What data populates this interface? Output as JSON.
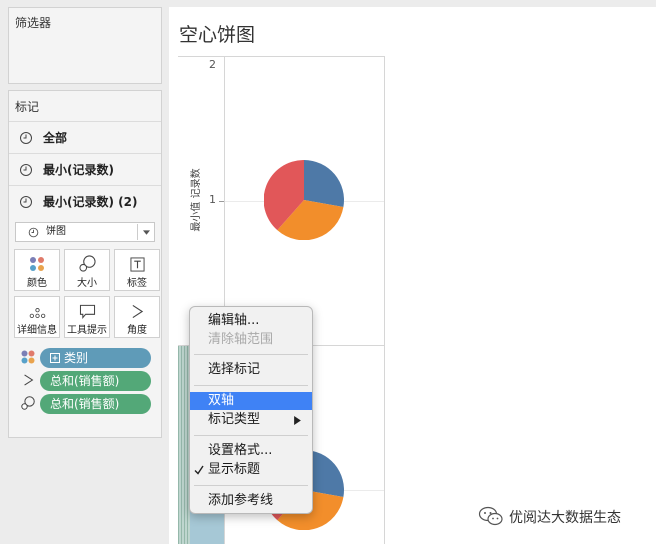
{
  "filters": {
    "title": "筛选器"
  },
  "marks": {
    "title": "标记",
    "layers": [
      "全部",
      "最小(记录数)",
      "最小(记录数) (2)"
    ],
    "mark_type": "饼图",
    "buttons": {
      "color": "颜色",
      "size": "大小",
      "label": "标签",
      "detail": "详细信息",
      "tooltip": "工具提示",
      "angle": "角度"
    },
    "pills": [
      "类别",
      "总和(销售额)",
      "总和(销售额)"
    ]
  },
  "view": {
    "title": "空心饼图",
    "axis_label": "最小值 记录数",
    "ticks": [
      "2",
      "1"
    ]
  },
  "pie_colors": {
    "blue": "#4e79a7",
    "orange": "#f28e2b",
    "red": "#e15759"
  },
  "context_menu": {
    "items": [
      {
        "label": "编辑轴...",
        "state": "normal"
      },
      {
        "label": "清除轴范围",
        "state": "disabled"
      },
      {
        "label": "选择标记",
        "state": "normal"
      },
      {
        "label": "双轴",
        "state": "active"
      },
      {
        "label": "标记类型",
        "state": "submenu"
      },
      {
        "label": "设置格式...",
        "state": "normal"
      },
      {
        "label": "显示标题",
        "state": "checked"
      },
      {
        "label": "添加参考线",
        "state": "normal"
      }
    ]
  },
  "watermark": "优阅达大数据生态"
}
